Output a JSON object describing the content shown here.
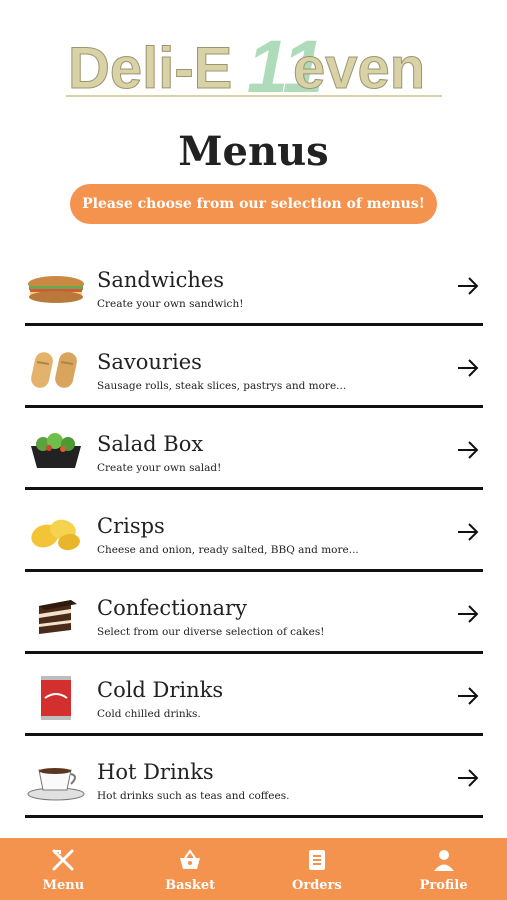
{
  "logo": {
    "text_left": "Deli-E",
    "text_mid": "11",
    "text_right": "even"
  },
  "page": {
    "title": "Menus",
    "subtitle": "Please choose from our selection of menus!"
  },
  "menu": {
    "items": [
      {
        "name": "Sandwiches",
        "desc": "Create your own sandwich!",
        "icon": "sandwich-icon"
      },
      {
        "name": "Savouries",
        "desc": "Sausage rolls, steak slices, pastrys and more...",
        "icon": "sausage-roll-icon"
      },
      {
        "name": "Salad Box",
        "desc": "Create your own salad!",
        "icon": "salad-icon"
      },
      {
        "name": "Crisps",
        "desc": "Cheese and onion, ready salted, BBQ and more...",
        "icon": "crisps-icon"
      },
      {
        "name": "Confectionary",
        "desc": "Select from our diverse selection of cakes!",
        "icon": "cake-icon"
      },
      {
        "name": "Cold Drinks",
        "desc": "Cold chilled drinks.",
        "icon": "cola-can-icon"
      },
      {
        "name": "Hot Drinks",
        "desc": "Hot drinks such as teas and coffees.",
        "icon": "coffee-cup-icon"
      }
    ]
  },
  "nav": {
    "items": [
      {
        "label": "Menu",
        "icon": "fork-knife-icon"
      },
      {
        "label": "Basket",
        "icon": "basket-icon"
      },
      {
        "label": "Orders",
        "icon": "receipt-icon"
      },
      {
        "label": "Profile",
        "icon": "person-icon"
      }
    ]
  },
  "colors": {
    "accent": "#f4934e",
    "logo_text": "#d9d2a6",
    "logo_eleven": "#a6d9b3"
  }
}
